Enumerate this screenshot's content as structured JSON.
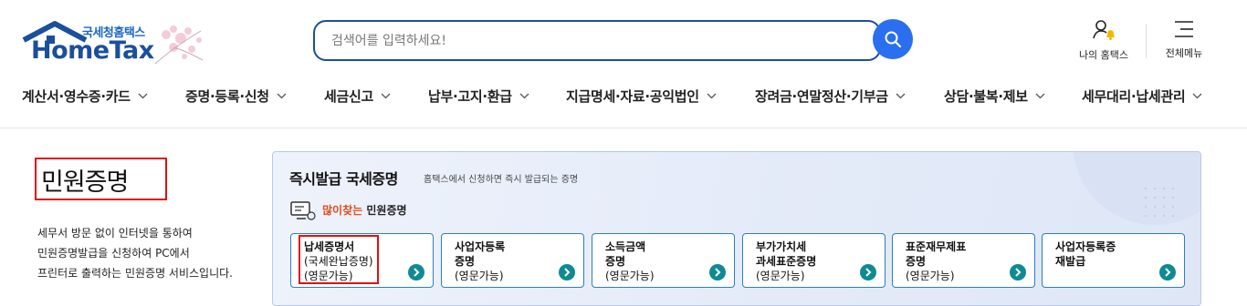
{
  "header": {
    "logo": {
      "sub": "국세청홈택스",
      "main": "HomeTax"
    },
    "search": {
      "placeholder": "검색어를 입력하세요!"
    },
    "utils": {
      "my_hometax": "나의 홈택스",
      "all_menu": "전체메뉴"
    }
  },
  "gnb": {
    "items": [
      {
        "label": "계산서·영수증·카드"
      },
      {
        "label": "증명·등록·신청"
      },
      {
        "label": "세금신고"
      },
      {
        "label": "납부·고지·환급"
      },
      {
        "label": "지급명세·자료·공익법인"
      },
      {
        "label": "장려금·연말정산·기부금"
      },
      {
        "label": "상담·불복·제보"
      },
      {
        "label": "세무대리·납세관리"
      }
    ]
  },
  "intro": {
    "title": "민원증명",
    "lines": [
      "세무서 방문 없이 인터넷을 통하여",
      "민원증명발급을 신청하여 PC에서",
      "프린터로 출력하는 민원증명 서비스입니다."
    ]
  },
  "instant": {
    "title": "즉시발급 국세증명",
    "desc": "홈택스에서 신청하면 즉시 발급되는 증명",
    "popular_hot": "많이찾는",
    "popular_label": "민원증명",
    "cards": [
      {
        "title1": "납세증명서",
        "title2": "",
        "sub1": "(국세완납증명)",
        "sub2": "(영문가능)"
      },
      {
        "title1": "사업자등록",
        "title2": "증명",
        "sub1": "(영문가능)",
        "sub2": ""
      },
      {
        "title1": "소득금액",
        "title2": "증명",
        "sub1": "(영문가능)",
        "sub2": ""
      },
      {
        "title1": "부가가치세",
        "title2": "과세표준증명",
        "sub1": "(영문가능)",
        "sub2": ""
      },
      {
        "title1": "표준재무제표",
        "title2": "증명",
        "sub1": "(영문가능)",
        "sub2": ""
      },
      {
        "title1": "사업자등록증",
        "title2": "재발급",
        "sub1": "",
        "sub2": ""
      }
    ]
  },
  "colors": {
    "brand_navy": "#1a4f9c",
    "search_button": "#2a6ff0",
    "card_go": "#0f8a93",
    "highlight": "#e01010",
    "hot_text": "#e04b1a"
  },
  "icons": [
    "house-logo-icon",
    "search-icon",
    "person-bell-icon",
    "hamburger-icon",
    "chevron-down-icon",
    "monitor-chat-icon",
    "arrow-right-icon"
  ]
}
